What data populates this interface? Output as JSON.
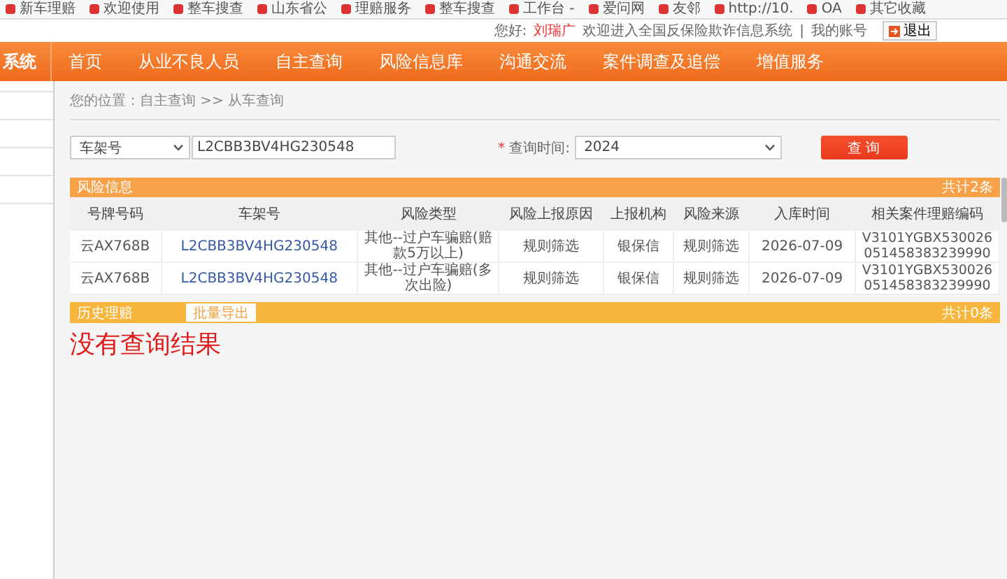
{
  "bookmarks": [
    "新车理赔",
    "欢迎使用",
    "整车搜查",
    "山东省公",
    "理赔服务",
    "整车搜查",
    "工作台 - ",
    "爱问网",
    "友邻",
    "http://10.",
    "OA",
    "其它收藏"
  ],
  "header": {
    "greeting": "您好:",
    "user": "刘瑞广",
    "welcome": "欢迎进入全国反保险欺诈信息系统",
    "separator": "|",
    "account": "我的账号",
    "logout": "退出"
  },
  "nav": {
    "logo": "系统",
    "items": [
      {
        "label": "首页",
        "selected": false
      },
      {
        "label": "从业不良人员",
        "selected": false
      },
      {
        "label": "自主查询",
        "selected": false
      },
      {
        "label": "风险信息库",
        "selected": false
      },
      {
        "label": "沟通交流",
        "selected": false
      },
      {
        "label": "案件调查及追偿",
        "selected": false
      },
      {
        "label": "增值服务",
        "selected": false
      }
    ]
  },
  "breadcrumb": "您的位置：自主查询 >> 从车查询",
  "search": {
    "type": "车架号",
    "value": "L2CBB3BV4HG230548",
    "required_mark": "*",
    "time_label": "查询时间:",
    "time": "2024",
    "button": "查 询"
  },
  "risk_panel": {
    "title": "风险信息",
    "count": "共计2条",
    "columns": [
      "号牌号码",
      "车架号",
      "风险类型",
      "风险上报原因",
      "上报机构",
      "风险来源",
      "入库时间",
      "相关案件理赔编码"
    ],
    "rows": [
      [
        "云AX768B",
        "L2CBB3BV4HG230548",
        "其他--过户车骗赔(赔款5万以上)",
        "规则筛选",
        "银保信",
        "规则筛选",
        "2026-07-09",
        "V3101YGBX530026051458383239990"
      ],
      [
        "云AX768B",
        "L2CBB3BV4HG230548",
        "其他--过户车骗赔(多次出险)",
        "规则筛选",
        "银保信",
        "规则筛选",
        "2026-07-09",
        "V3101YGBX530026051458383239990"
      ]
    ]
  },
  "history_panel": {
    "title": "历史理赔",
    "export": "批量导出",
    "count": "共计0条"
  },
  "empty_message": "没有查询结果"
}
